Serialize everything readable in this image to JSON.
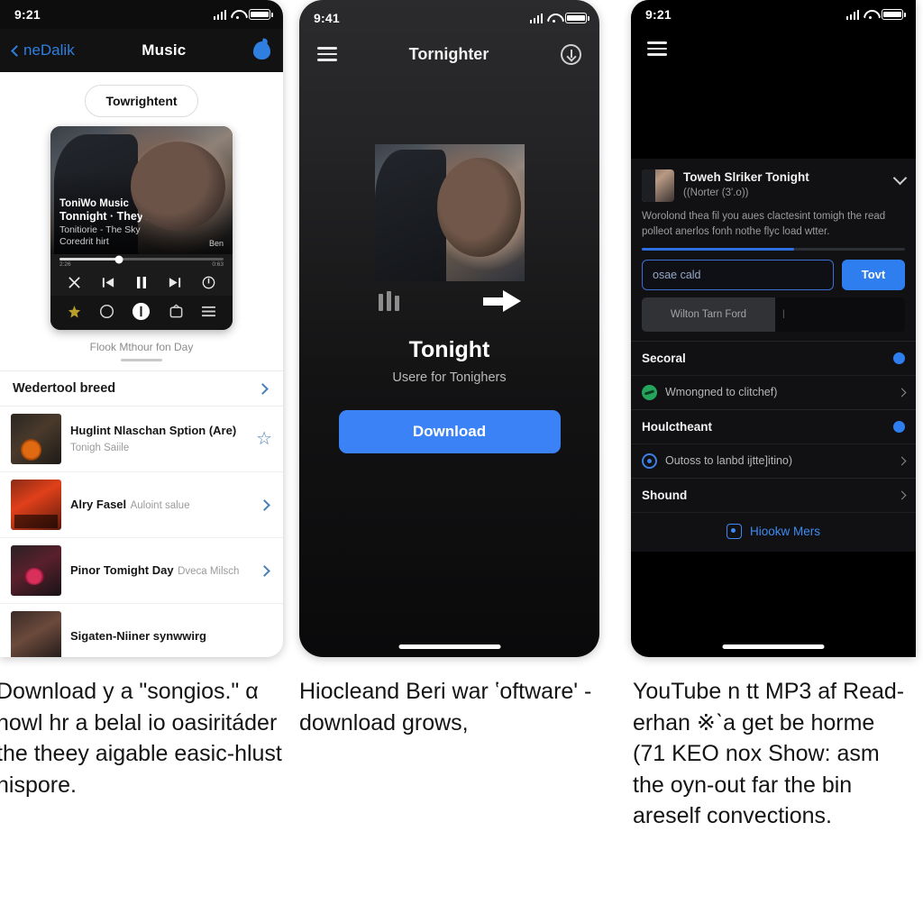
{
  "panel1": {
    "status": {
      "time": "9:21",
      "signal_icon": "cellular-bars-icon",
      "wifi_icon": "wifi-icon",
      "battery_icon": "battery-icon"
    },
    "nav": {
      "back_label": "neDalik",
      "title": "Music",
      "right_icon": "apple-music-icon"
    },
    "pill_label": "Towrightent",
    "player": {
      "app_name": "ToniWo Music",
      "track_title": "Tonnight · They'light",
      "subtitle": "Tonitiorie - The Sky",
      "subtitle2": "Coredrit hirt",
      "badge": "Ben",
      "time_elapsed": "2:26",
      "time_total": "0:63",
      "controls": [
        "close-icon",
        "previous-icon",
        "pause-icon",
        "next-icon",
        "power-icon"
      ],
      "tabs": [
        "sparkle-icon",
        "circle-icon",
        "record-icon",
        "tv-icon",
        "list-icon"
      ]
    },
    "card_caption": "Flook Mthour fon Day",
    "list_header": "Wedertool breed",
    "list": [
      {
        "title": "Huglint Nlaschan Sption (Are)",
        "subtitle": "Tonigh Saiile",
        "action_icon": "star-icon"
      },
      {
        "title": "Alry Fasel",
        "subtitle": "Auloint salue",
        "action_icon": "chevron-right-icon"
      },
      {
        "title": "Pinor Tomight Day",
        "subtitle": "Dveca Milsch",
        "action_icon": "chevron-right-icon"
      },
      {
        "title": "Sigaten-Niiner synwwirg",
        "subtitle": "",
        "action_icon": "chevron-right-icon"
      }
    ]
  },
  "panel2": {
    "status": {
      "time": "9:41"
    },
    "nav": {
      "menu_icon": "hamburger-menu-icon",
      "title": "Tornighter",
      "right_icon": "download-circle-icon"
    },
    "hero": {
      "equalizer_icon": "equalizer-icon",
      "arrow_icon": "arrow-right-icon"
    },
    "heading": "Tonight",
    "subheading": "Usere for Tonighers",
    "button_label": "Download"
  },
  "panel3": {
    "status": {
      "time": "9:21"
    },
    "nav": {
      "menu_icon": "hamburger-menu-icon"
    },
    "sheet": {
      "title": "Toweh Slriker Tonight",
      "subtitle": "((Norter (3'.o))",
      "collapse_icon": "chevron-down-icon",
      "description": "Worolond thea fil you aues clactesint tomigh the read polleot anerlos fonh nothe flyc load wtter.",
      "progress_percent": 58,
      "input_value": "osae cald",
      "go_label": "Tovt",
      "chip_label": "Wilton Tarn Ford",
      "sections": [
        {
          "label": "Secoral",
          "badge_icon": "blue-dot-icon"
        },
        {
          "label": "Houlctheant",
          "badge_icon": "blue-dot-icon"
        }
      ],
      "items": [
        {
          "label": "Wmongned to clitchef)",
          "icon": "green-circle-icon"
        },
        {
          "label": "Outoss to lanbd ijtte]itino)",
          "icon": "blue-ring-icon"
        }
      ],
      "sound_label": "Shound",
      "more_label": "Hiookw Mers",
      "more_icon": "square-dot-icon"
    }
  },
  "captions": {
    "one": "Download у a \"songios.\" α nowl hr a belal io oasiritáder the theey aigable easic-hlust nispore.",
    "two": "Hiocleand Beri war ʽoftware' - download grows,",
    "three": "YouTube n tt MP3 af Read-erhan ※ˋa get be horme (71 KEO nox Show: asm the oyn-out far the bin areself convections."
  },
  "colors": {
    "accent_blue": "#3b82f6",
    "link_blue": "#2f7fe0",
    "green": "#25a55c",
    "dark_bg": "#111113"
  }
}
